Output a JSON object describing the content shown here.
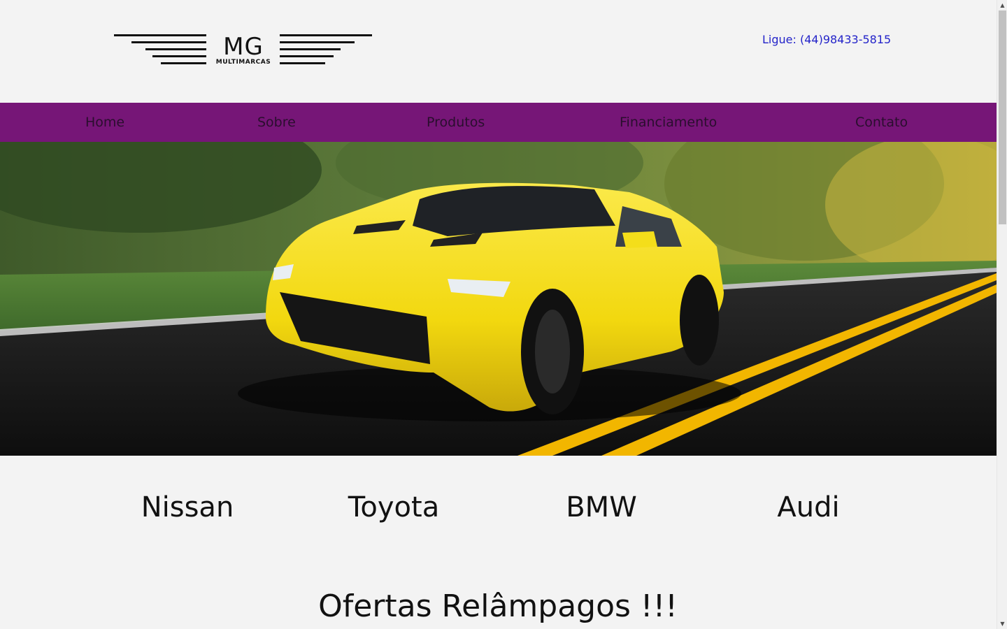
{
  "header": {
    "logo_main": "MG",
    "logo_sub": "MULTIMARCAS",
    "phone": "Ligue: (44)98433-5815"
  },
  "nav": {
    "items": [
      {
        "label": "Home"
      },
      {
        "label": "Sobre"
      },
      {
        "label": "Produtos"
      },
      {
        "label": "Financiamento"
      },
      {
        "label": "Contato"
      }
    ]
  },
  "colors": {
    "nav_background": "#761677",
    "phone_link": "#2323c9",
    "page_background": "#f3f3f3",
    "hero_car": "#f4de1a",
    "road_lines": "#f2b600"
  },
  "brands": {
    "items": [
      {
        "label": "Nissan"
      },
      {
        "label": "Toyota"
      },
      {
        "label": "BMW"
      },
      {
        "label": "Audi"
      }
    ]
  },
  "offers": {
    "title": "Ofertas Relâmpagos !!!"
  }
}
